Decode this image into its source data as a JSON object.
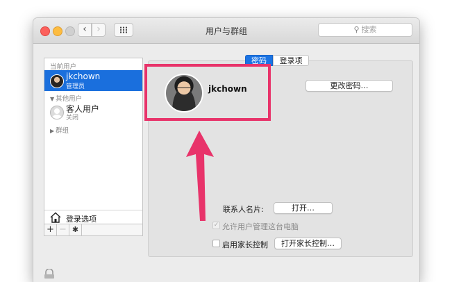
{
  "window": {
    "title": "用户与群组"
  },
  "search": {
    "placeholder": "搜索",
    "icon": "search-icon"
  },
  "colors": {
    "selection": "#1a6fdd",
    "highlight_box": "#e8336a",
    "tab_active": "#1b74e4"
  },
  "sidebar": {
    "current_header": "当前用户",
    "current_user": {
      "name": "jkchown",
      "role": "管理员",
      "icon": "user-avatar"
    },
    "other_header": "其他用户",
    "guest": {
      "name": "客人用户",
      "status": "关闭",
      "icon": "guest-avatar"
    },
    "groups_header": "群组",
    "login_options": "登录选项",
    "toolbar": {
      "add": "+",
      "remove": "−",
      "gear": "✱"
    }
  },
  "tabs": {
    "password": "密码",
    "login_items": "登录项"
  },
  "profile": {
    "name": "jkchown"
  },
  "buttons": {
    "change_password": "更改密码…",
    "open_contact": "打开…",
    "open_parental": "打开家长控制…"
  },
  "fields": {
    "contact_card_label": "联系人名片:",
    "allow_admin_label": "允许用户管理这台电脑",
    "parental_label": "启用家长控制"
  }
}
